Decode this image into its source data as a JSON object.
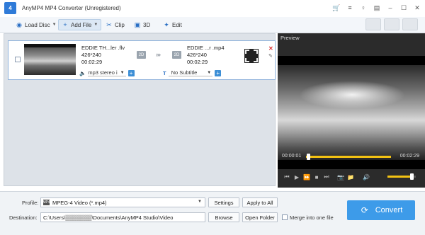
{
  "window": {
    "title": "AnyMP4 MP4 Converter (Unregistered)",
    "logo_text": "4",
    "icons": [
      "cart-icon",
      "menu-icon",
      "key-icon",
      "register-icon",
      "minimize-icon",
      "maximize-icon",
      "close-icon"
    ]
  },
  "toolbar": {
    "load_disc": "Load Disc",
    "add_file": "Add File",
    "clip": "Clip",
    "three_d": "3D",
    "edit": "Edit"
  },
  "file": {
    "source": {
      "name": "EDDIE TH...ler .flv",
      "resolution": "426*240",
      "duration": "00:02:29",
      "mode": "2D"
    },
    "output": {
      "name": "EDDIE ...r .mp4",
      "resolution": "426*240",
      "duration": "00:02:29",
      "mode": "2D"
    },
    "audio_track": "mp3 stereo i",
    "subtitle": "No Subtitle"
  },
  "preview": {
    "label": "Preview",
    "time_current": "00:00:01",
    "time_total": "00:02:29",
    "progress": 0.01,
    "volume": 0.85
  },
  "bottom": {
    "profile_label": "Profile:",
    "profile_value": "MPEG-4 Video (*.mp4)",
    "profile_icon_text": "MP4",
    "settings": "Settings",
    "apply_all": "Apply to All",
    "destination_label": "Destination:",
    "destination_value": "C:\\Users\\▒▒▒▒▒▒▒\\Documents\\AnyMP4 Studio\\Video",
    "browse": "Browse",
    "open_folder": "Open Folder",
    "merge": "Merge into one file",
    "convert": "Convert"
  },
  "colors": {
    "accent": "#3d9be9",
    "progress": "#f3c213"
  }
}
